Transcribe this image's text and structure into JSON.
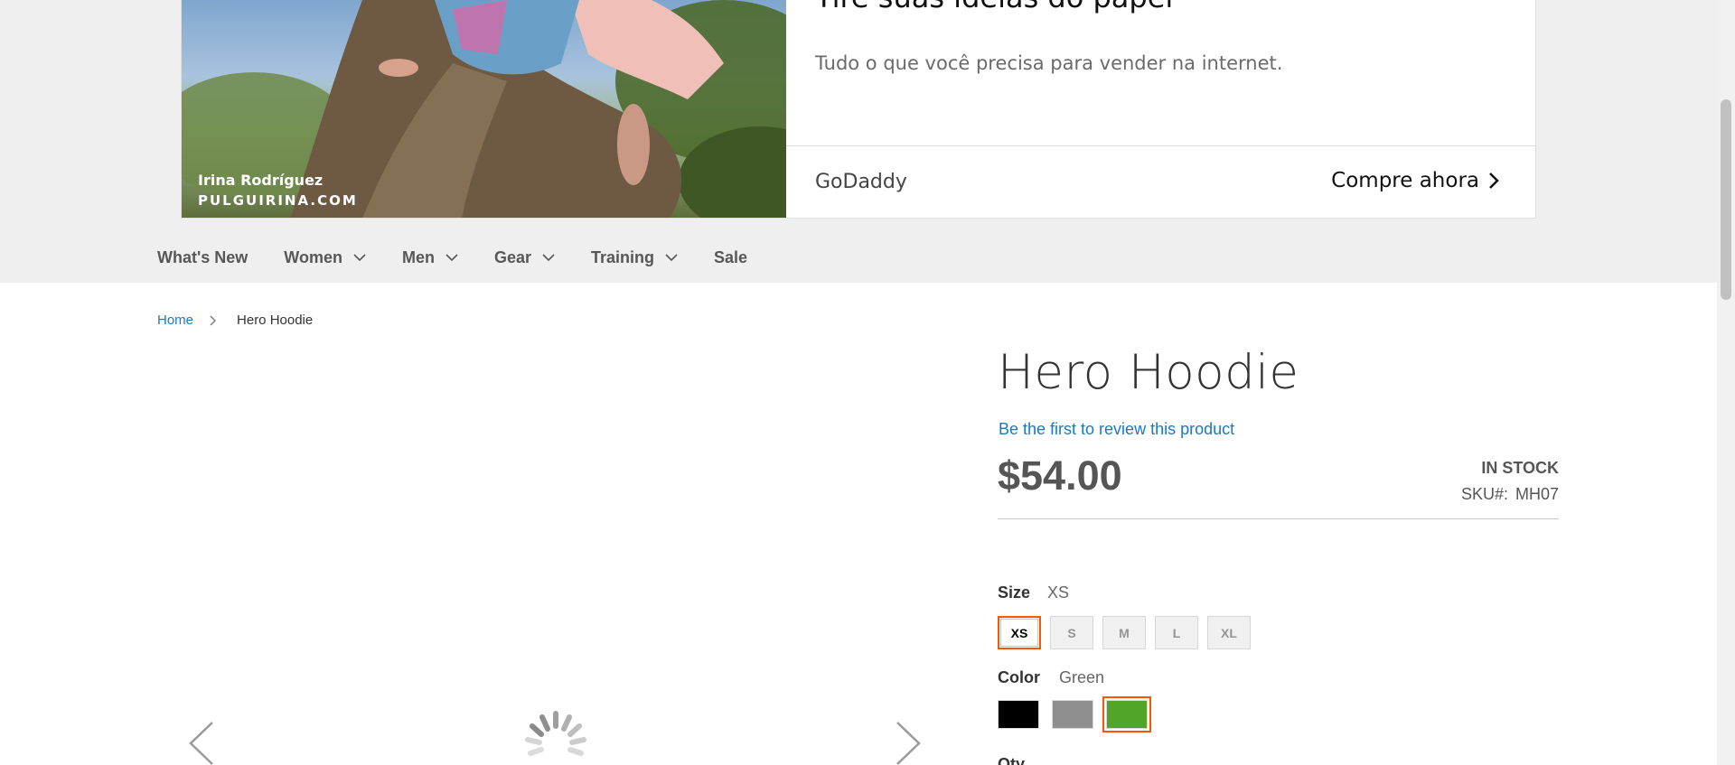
{
  "ad": {
    "headline": "Tire suas ideias do papel",
    "subtext": "Tudo o que você precisa para vender na internet.",
    "brand": "GoDaddy",
    "cta": "Compre ahora",
    "credit_name": "Irina Rodríguez",
    "credit_site": "PULGUIRINA.COM"
  },
  "nav": {
    "items": [
      {
        "label": "What's New",
        "has_dropdown": false
      },
      {
        "label": "Women",
        "has_dropdown": true
      },
      {
        "label": "Men",
        "has_dropdown": true
      },
      {
        "label": "Gear",
        "has_dropdown": true
      },
      {
        "label": "Training",
        "has_dropdown": true
      },
      {
        "label": "Sale",
        "has_dropdown": false
      }
    ]
  },
  "breadcrumb": {
    "home": "Home",
    "current": "Hero Hoodie"
  },
  "product": {
    "title": "Hero Hoodie",
    "review_link": "Be the first to review this product",
    "price": "$54.00",
    "stock": "IN STOCK",
    "sku_label": "SKU#:",
    "sku": "MH07",
    "size_label": "Size",
    "size_selected": "XS",
    "sizes": [
      "XS",
      "S",
      "M",
      "L",
      "XL"
    ],
    "color_label": "Color",
    "color_selected": "Green",
    "colors": [
      {
        "name": "Black",
        "hex": "#000000"
      },
      {
        "name": "Gray",
        "hex": "#8f8f8f"
      },
      {
        "name": "Green",
        "hex": "#53a52a"
      }
    ],
    "qty_label": "Qty"
  },
  "theme": {
    "link": "#1979c3",
    "selected_border": "#ff5501",
    "band": "#efefef"
  }
}
